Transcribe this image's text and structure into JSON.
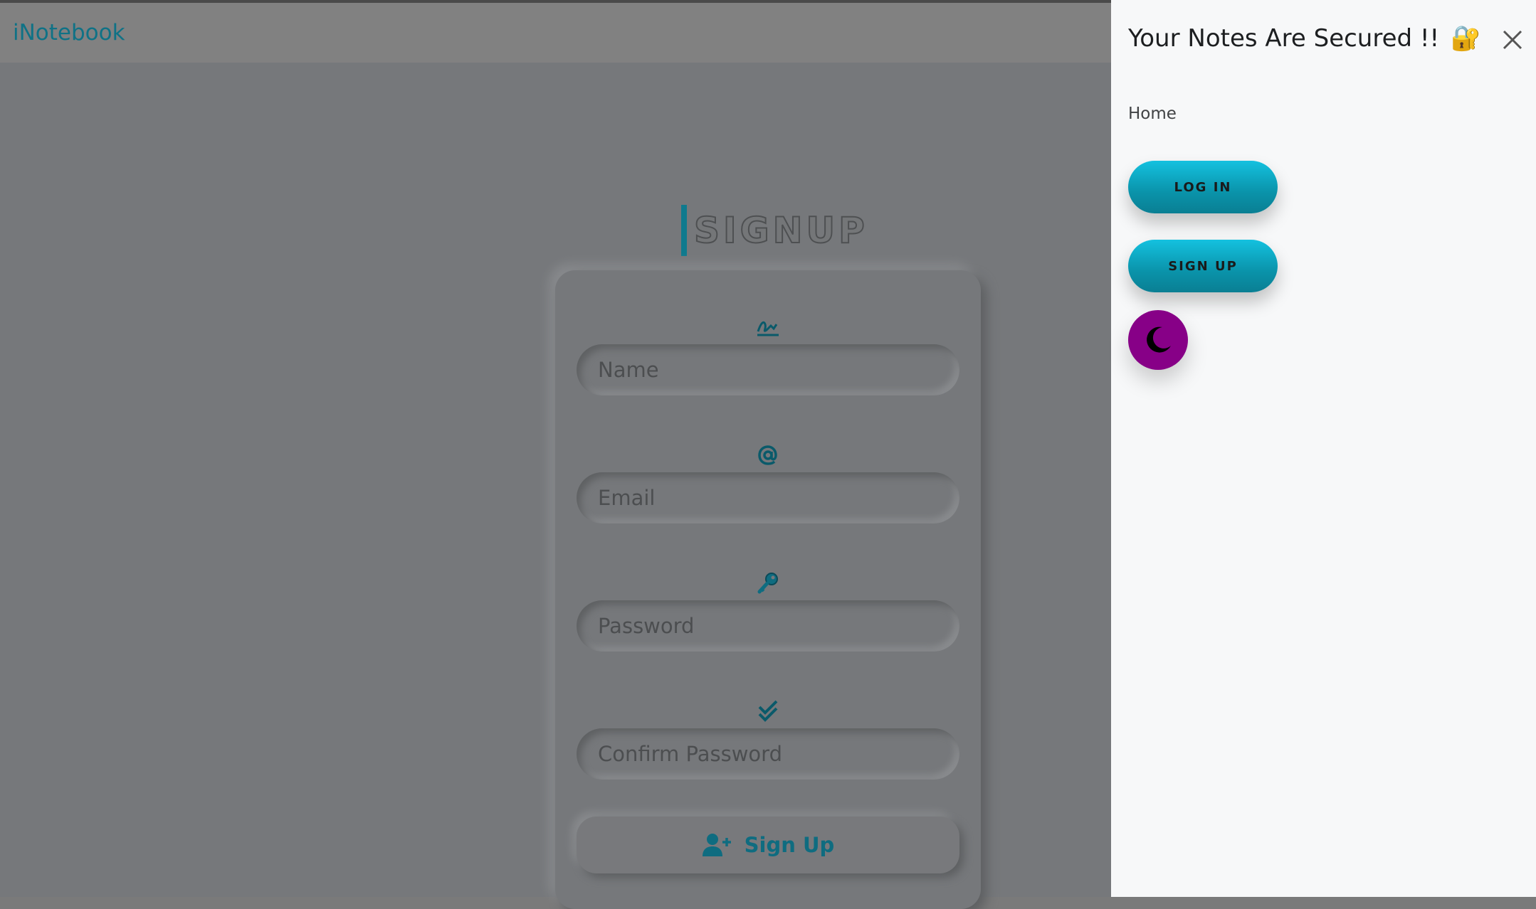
{
  "navbar": {
    "brand": "iNotebook"
  },
  "signup": {
    "title": "SIGNUP",
    "fields": {
      "name_placeholder": "Name",
      "email_placeholder": "Email",
      "password_placeholder": "Password",
      "confirm_placeholder": "Confirm Password"
    },
    "icons": {
      "name": "signature-icon",
      "email": "at-sign-icon",
      "password": "key-icon",
      "confirm": "double-check-icon",
      "submit": "user-plus-icon"
    },
    "submit_label": "Sign Up"
  },
  "drawer": {
    "title": "Your Notes Are Secured !!",
    "title_emoji": "🔐",
    "home_link": "Home",
    "login_label": "LOG IN",
    "signup_label": "SIGN UP",
    "theme_toggle_icon": "moon-icon",
    "close_icon": "close-icon"
  },
  "colors": {
    "accent": "#0f7a8e",
    "pill_gradient_top": "#14c1df",
    "theme_toggle": "#870087",
    "drawer_bg": "#f7f8f9",
    "overlay_bg": "#76787b"
  }
}
